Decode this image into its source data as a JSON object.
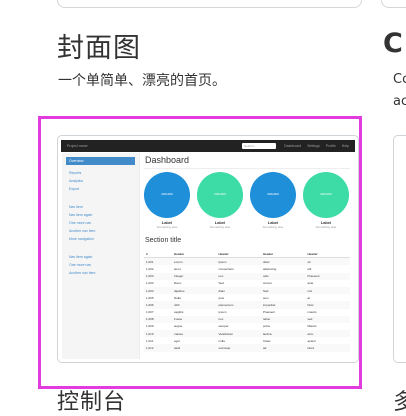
{
  "cards": [
    {
      "title": "封面图",
      "description": "一个单简单、漂亮的首页。",
      "selected": true
    },
    {
      "title": "C",
      "description_lines": [
        "Cc",
        "ac"
      ]
    }
  ],
  "next_row": {
    "title_left": "控制台",
    "title_right": "多"
  },
  "selection_color": "#e23ce0",
  "preview": {
    "brand": "Project name",
    "search_placeholder": "Search...",
    "nav_links": [
      "Dashboard",
      "Settings",
      "Profile",
      "Help"
    ],
    "sidebar_groups": [
      [
        "Overview",
        "Reports",
        "Analytics",
        "Export"
      ],
      [
        "Nav item",
        "Nav item again",
        "One more nav",
        "Another nav item",
        "More navigation"
      ],
      [
        "Nav item again",
        "One more nav",
        "Another nav item"
      ]
    ],
    "active_sidebar_item": "Overview",
    "dashboard_title": "Dashboard",
    "placeholders": [
      {
        "circle_text": "200x200",
        "label": "Label",
        "sub": "Something else",
        "color": "#1f8fda"
      },
      {
        "circle_text": "200x200",
        "label": "Label",
        "sub": "Something else",
        "color": "#3ddba6"
      },
      {
        "circle_text": "200x200",
        "label": "Label",
        "sub": "Something else",
        "color": "#1f8fda"
      },
      {
        "circle_text": "200x200",
        "label": "Label",
        "sub": "Something else",
        "color": "#3ddba6"
      }
    ],
    "section_title": "Section title",
    "table_headers": [
      "#",
      "Header",
      "Header",
      "Header",
      "Header"
    ],
    "table_rows": [
      [
        "1,001",
        "Lorem",
        "ipsum",
        "dolor",
        "sit"
      ],
      [
        "1,002",
        "amet",
        "consectetur",
        "adipiscing",
        "elit"
      ],
      [
        "1,003",
        "Integer",
        "nec",
        "odio",
        "Praesent"
      ],
      [
        "1,003",
        "libero",
        "Sed",
        "cursus",
        "ante"
      ],
      [
        "1,004",
        "dapibus",
        "diam",
        "Sed",
        "nisi"
      ],
      [
        "1,005",
        "Nulla",
        "quis",
        "sem",
        "at"
      ],
      [
        "1,006",
        "nibh",
        "elementum",
        "imperdiet",
        "Duis"
      ],
      [
        "1,007",
        "sagittis",
        "ipsum",
        "Praesent",
        "mauris"
      ],
      [
        "1,008",
        "Fusce",
        "nec",
        "tellus",
        "sed"
      ],
      [
        "1,009",
        "augue",
        "semper",
        "porta",
        "Mauris"
      ],
      [
        "1,010",
        "massa",
        "Vestibulum",
        "lacinia",
        "arcu"
      ],
      [
        "1,011",
        "eget",
        "nulla",
        "Class",
        "aptent"
      ],
      [
        "1,012",
        "taciti",
        "sociosqu",
        "ad",
        "litora"
      ]
    ]
  }
}
